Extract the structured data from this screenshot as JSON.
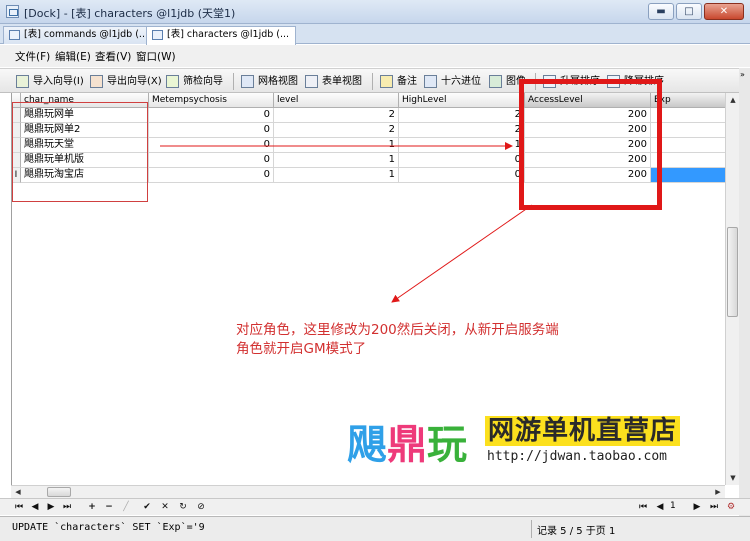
{
  "window": {
    "title": "[Dock] - [表] characters @l1jdb (天堂1)",
    "buttons": {
      "minimize": "▬",
      "maximize": "□",
      "close": "✕"
    }
  },
  "tabs": [
    {
      "label": "[表] commands @l1jdb (..."
    },
    {
      "label": "[表] characters @l1jdb (..."
    }
  ],
  "menu": [
    "文件(F)",
    "编辑(E)",
    "查看(V)",
    "窗口(W)"
  ],
  "toolbar": {
    "import": "导入向导(I)",
    "export": "导出向导(X)",
    "filter": "筛检向导",
    "grid_view": "网格视图",
    "form_view": "表单视图",
    "memo": "备注",
    "hex": "十六进位",
    "image": "图像",
    "sort_asc": "升幂排序",
    "sort_desc": "降幂排序"
  },
  "grid": {
    "columns": [
      "char_name",
      "Metempsychosis",
      "level",
      "HighLevel",
      "AccessLevel",
      "Exp"
    ],
    "rows": [
      {
        "char_name": "飓鼎玩网单",
        "Metempsychosis": "0",
        "level": "2",
        "HighLevel": "2",
        "AccessLevel": "200",
        "indicator": ""
      },
      {
        "char_name": "飓鼎玩网单2",
        "Metempsychosis": "0",
        "level": "2",
        "HighLevel": "2",
        "AccessLevel": "200",
        "indicator": ""
      },
      {
        "char_name": "飓鼎玩天堂",
        "Metempsychosis": "0",
        "level": "1",
        "HighLevel": "1",
        "AccessLevel": "200",
        "indicator": ""
      },
      {
        "char_name": "飓鼎玩单机版",
        "Metempsychosis": "0",
        "level": "1",
        "HighLevel": "0",
        "AccessLevel": "200",
        "indicator": ""
      },
      {
        "char_name": "飓鼎玩淘宝店",
        "Metempsychosis": "0",
        "level": "1",
        "HighLevel": "0",
        "AccessLevel": "200",
        "indicator": "I"
      }
    ]
  },
  "navbar": {
    "first": "⏮",
    "prev": "◀",
    "next": "▶",
    "last": "⏭",
    "add": "+",
    "delete": "−",
    "edit": "╱",
    "apply": "✔",
    "cancel": "✕",
    "refresh": "↻",
    "stop": "⊘",
    "page_first": "⏮",
    "page_prev": "◀",
    "page_number": "1",
    "page_next": "▶",
    "page_last": "⏭",
    "settings": "⚙"
  },
  "status": {
    "sql": "UPDATE `characters` SET `Exp`='9",
    "record": "记录 5 / 5 于页 1"
  },
  "annotation": {
    "line1": "对应角色，这里修改为200然后关闭，从新开启服务端",
    "line2": "角色就开启GM模式了"
  },
  "watermark": {
    "brand_1": "飓",
    "brand_2": "鼎",
    "brand_3": "玩",
    "slogan": "网游单机直营店",
    "url": "http://jdwan.taobao.com"
  },
  "colors": {
    "annotation_red": "#e01818",
    "selection_blue": "#3399ff",
    "watermark_blue": "#2fa0e8",
    "watermark_pink": "#ee3a7a",
    "watermark_green": "#39b13a",
    "watermark_yellow": "#fce01e"
  }
}
